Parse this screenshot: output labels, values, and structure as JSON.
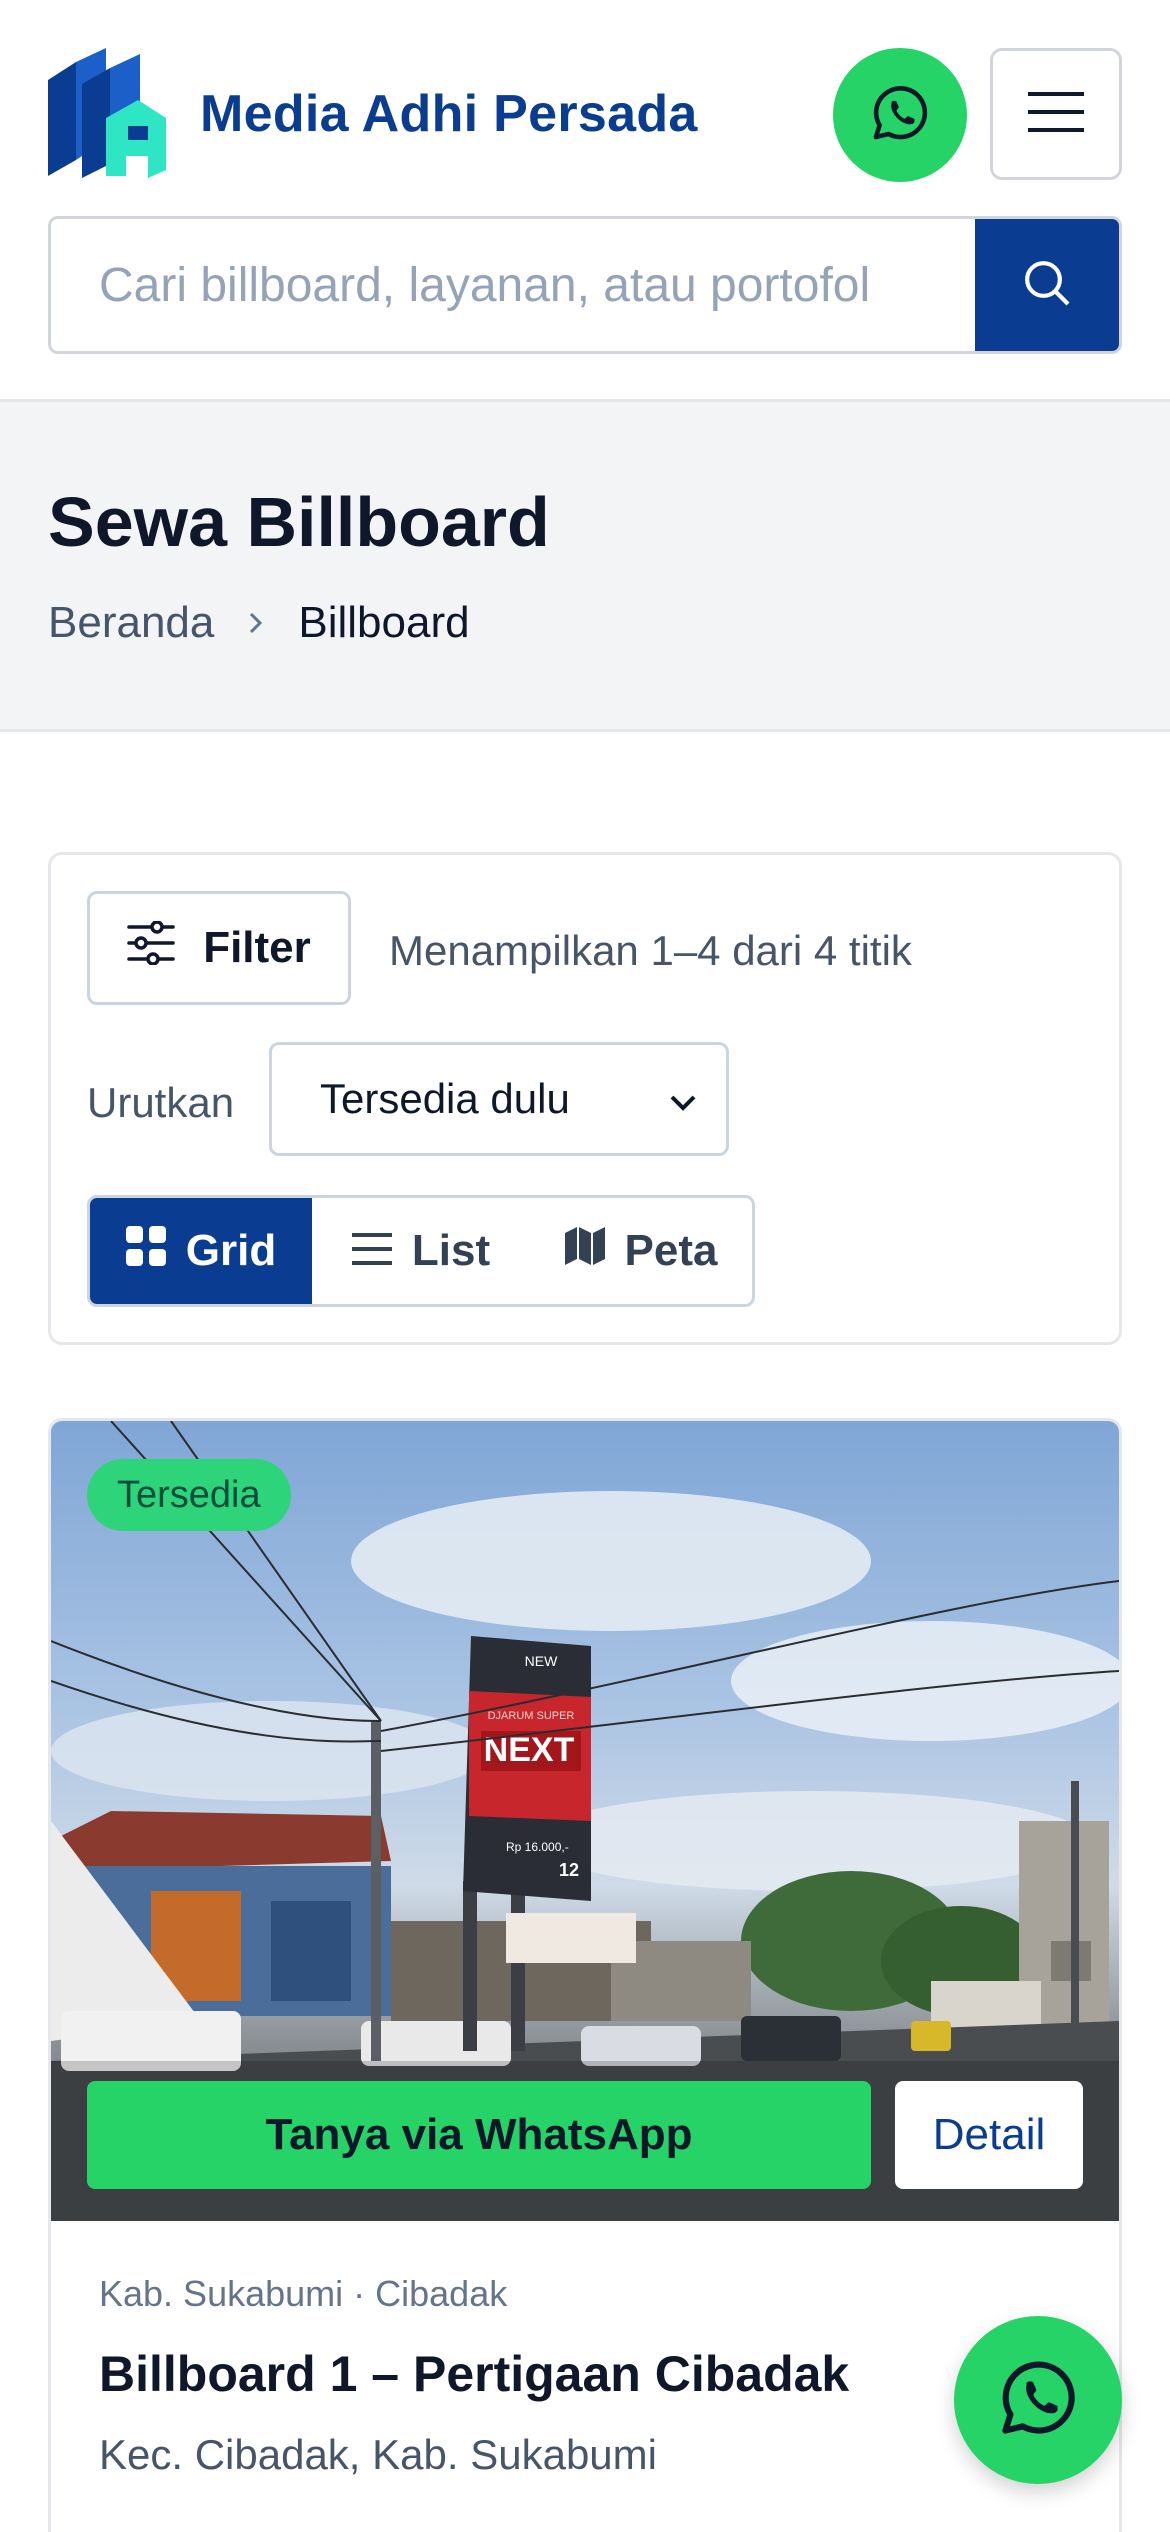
{
  "header": {
    "brand": "Media Adhi Persada",
    "search_placeholder": "Cari billboard, layanan, atau portofol"
  },
  "title_band": {
    "title": "Sewa Billboard",
    "breadcrumb": {
      "home": "Beranda",
      "current": "Billboard"
    }
  },
  "filters": {
    "filter_label": "Filter",
    "result_text": "Menampilkan 1–4 dari 4 titik",
    "sort_label": "Urutkan",
    "sort_selected": "Tersedia dulu",
    "views": [
      {
        "label": "Grid",
        "active": true
      },
      {
        "label": "List",
        "active": false
      },
      {
        "label": "Peta",
        "active": false
      }
    ]
  },
  "listing": {
    "status_badge": "Tersedia",
    "whatsapp_cta": "Tanya via WhatsApp",
    "detail_label": "Detail",
    "region": "Kab. Sukabumi · Cibadak",
    "title": "Billboard 1 – Pertigaan Cibadak",
    "subtitle": "Kec. Cibadak, Kab. Sukabumi",
    "billboard_text": {
      "top": "NEW",
      "brand": "NEXT",
      "sub": "DJARUM SUPER",
      "price": "Rp 16.000,-",
      "count": "12"
    }
  },
  "colors": {
    "brand_blue": "#0a3d91",
    "whatsapp_green": "#25d366",
    "badge_green": "#2ed47a"
  },
  "icons": [
    "logo-mark",
    "whatsapp-icon",
    "hamburger-menu-icon",
    "search-icon",
    "chevron-right-icon",
    "sliders-icon",
    "chevron-down-icon",
    "grid-icon",
    "list-icon",
    "map-icon"
  ]
}
